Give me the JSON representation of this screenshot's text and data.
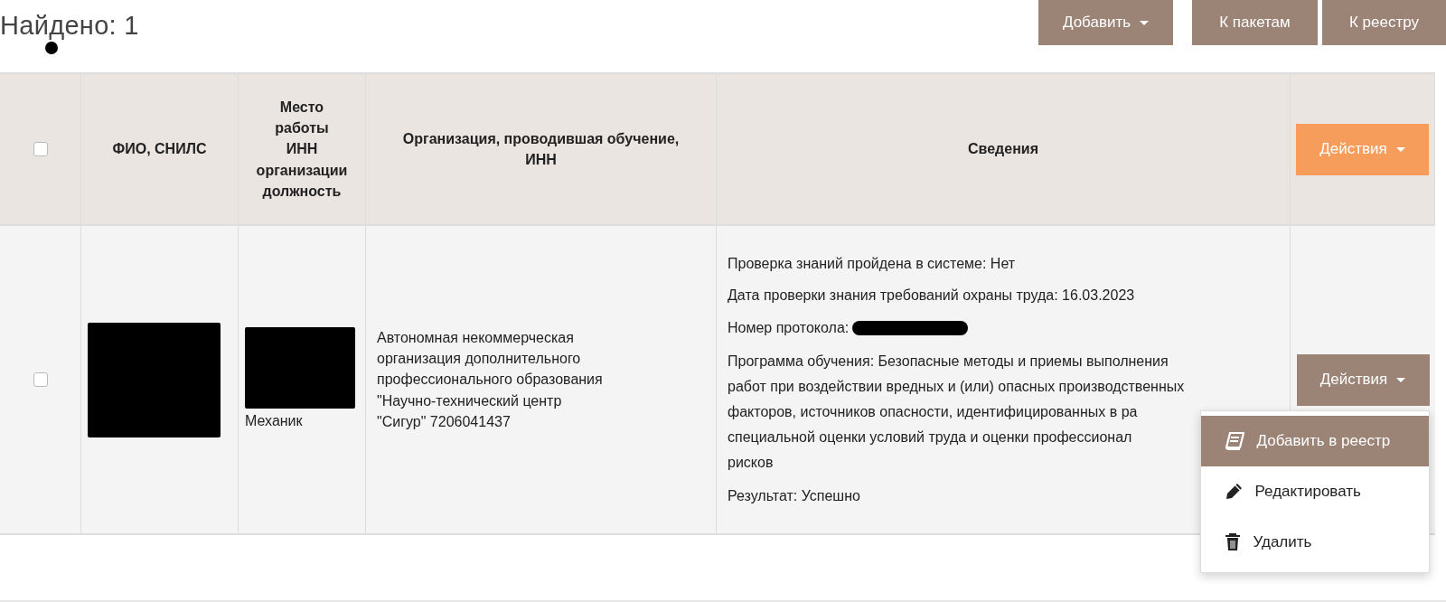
{
  "found": "Найдено: 1",
  "toolbar": [
    {
      "label": "Добавить",
      "caret": true
    },
    {
      "label": "К пакетам",
      "caret": false
    },
    {
      "label": "К реестру",
      "caret": false
    }
  ],
  "table": {
    "header": {
      "checked": false,
      "columns": [
        "ФИО, СНИЛС",
        "Место\nработы\nИНН\nорганизации\nдолжность",
        "Организация, проводившая обучение,\nИНН",
        "Сведения"
      ],
      "actions": {
        "label": "Действия",
        "color": "#f79d5c"
      }
    },
    "rows": [
      {
        "checked": false,
        "fio": [
          {
            "kind": "redacted"
          }
        ],
        "workplace": [
          {
            "kind": "redacted"
          },
          {
            "kind": "text",
            "text": "Механик"
          }
        ],
        "organization": "Автономная некоммерческая организация дополнительного профессионального образования \"Научно-технический центр \"Сигур\" 7206041437",
        "details": [
          {
            "kind": "text",
            "text": "Проверка знаний пройдена в системе: Нет"
          },
          {
            "kind": "text",
            "text": "Дата проверки знания требований охраны труда: 16.03.2023"
          },
          {
            "kind": "redacted",
            "text": "Номер протокола:"
          },
          {
            "kind": "lines",
            "lines": [
              "Программа обучения: Безопасные методы и приемы выполнения",
              "работ при воздействии вредных и (или) опасных производственных",
              "факторов, источников опасности, идентифицированных в ра",
              "специальной оценки условий труда и оценки профессионал",
              "рисков"
            ]
          },
          {
            "kind": "text",
            "text": "Результат: Успешно"
          }
        ],
        "actions": {
          "label": "Действия",
          "color": "#9b8376",
          "expanded": true
        },
        "menu": [
          {
            "label": "Добавить в реестр",
            "kind": "book",
            "selected": true
          },
          {
            "label": "Редактировать",
            "kind": "pencil",
            "selected": false
          },
          {
            "label": "Удалить",
            "kind": "trash",
            "selected": false
          }
        ]
      }
    ]
  }
}
